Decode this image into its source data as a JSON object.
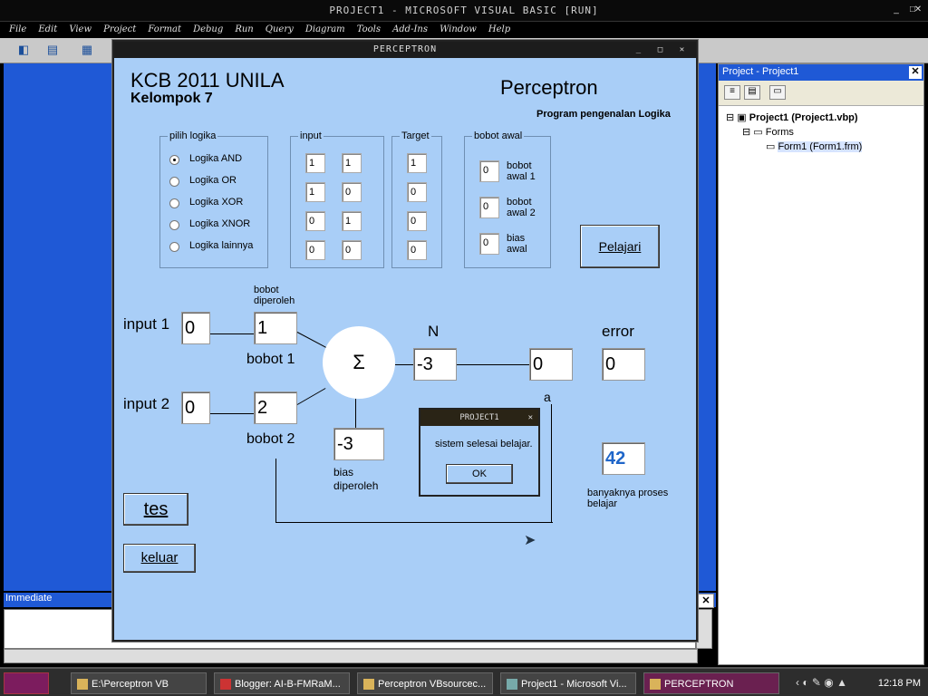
{
  "vb": {
    "title": "PROJECT1 - MICROSOFT VISUAL BASIC [RUN]",
    "menu": [
      "File",
      "Edit",
      "View",
      "Project",
      "Format",
      "Debug",
      "Run",
      "Query",
      "Diagram",
      "Tools",
      "Add-Ins",
      "Window",
      "Help"
    ],
    "immediate_label": "Immediate"
  },
  "project": {
    "header": "Project - Project1",
    "root": "Project1 (Project1.vbp)",
    "folder": "Forms",
    "form_file": "Form1 (Form1.frm)"
  },
  "form": {
    "title": "PERCEPTRON",
    "heading": "KCB 2011 UNILA",
    "subheading": "Kelompok 7",
    "app_title": "Perceptron",
    "app_subtitle": "Program pengenalan Logika",
    "logic_group": {
      "legend": "pilih logika",
      "options": [
        "Logika AND",
        "Logika OR",
        "Logika XOR",
        "Logika XNOR",
        "Logika lainnya"
      ],
      "selected_index": 0
    },
    "input_group": {
      "legend": "input",
      "rows": [
        [
          "1",
          "1"
        ],
        [
          "1",
          "0"
        ],
        [
          "0",
          "1"
        ],
        [
          "0",
          "0"
        ]
      ]
    },
    "target_group": {
      "legend": "Target",
      "values": [
        "1",
        "0",
        "0",
        "0"
      ]
    },
    "weights_group": {
      "legend": "bobot awal",
      "items": [
        {
          "value": "0",
          "label1": "bobot",
          "label2": "awal 1"
        },
        {
          "value": "0",
          "label1": "bobot",
          "label2": "awal 2"
        },
        {
          "value": "0",
          "label1": "bias",
          "label2": "awal"
        }
      ]
    },
    "learn_button": "Pelajari",
    "diagram": {
      "input1_label": "input 1",
      "input1_value": "0",
      "input2_label": "input 2",
      "input2_value": "0",
      "weights_heading1": "bobot",
      "weights_heading2": "diperoleh",
      "weight1_value": "1",
      "weight1_label": "bobot 1",
      "weight2_value": "2",
      "weight2_label": "bobot 2",
      "sigma": "Σ",
      "n_label": "N",
      "n_value": "-3",
      "output_value": "0",
      "a_label": "a",
      "error_label": "error",
      "error_value": "0",
      "bias_value": "-3",
      "bias_label1": "bias",
      "bias_label2": "diperoleh",
      "count_value": "42",
      "count_label1": "banyaknya proses",
      "count_label2": "belajar"
    },
    "test_button": "tes",
    "exit_button": "keluar"
  },
  "msgbox": {
    "title": "PROJECT1",
    "message": "sistem selesai belajar.",
    "ok": "OK"
  },
  "taskbar": {
    "items": [
      "E:\\Perceptron VB",
      "Blogger: AI-B-FMRaM...",
      "Perceptron VBsourcec...",
      "Project1 - Microsoft Vi...",
      "PERCEPTRON"
    ],
    "clock": "12:18 PM"
  },
  "colors": {
    "form_bg": "#a9cef7",
    "mdi_bg": "#1f59d6",
    "accent_number": "#1f66c9"
  }
}
